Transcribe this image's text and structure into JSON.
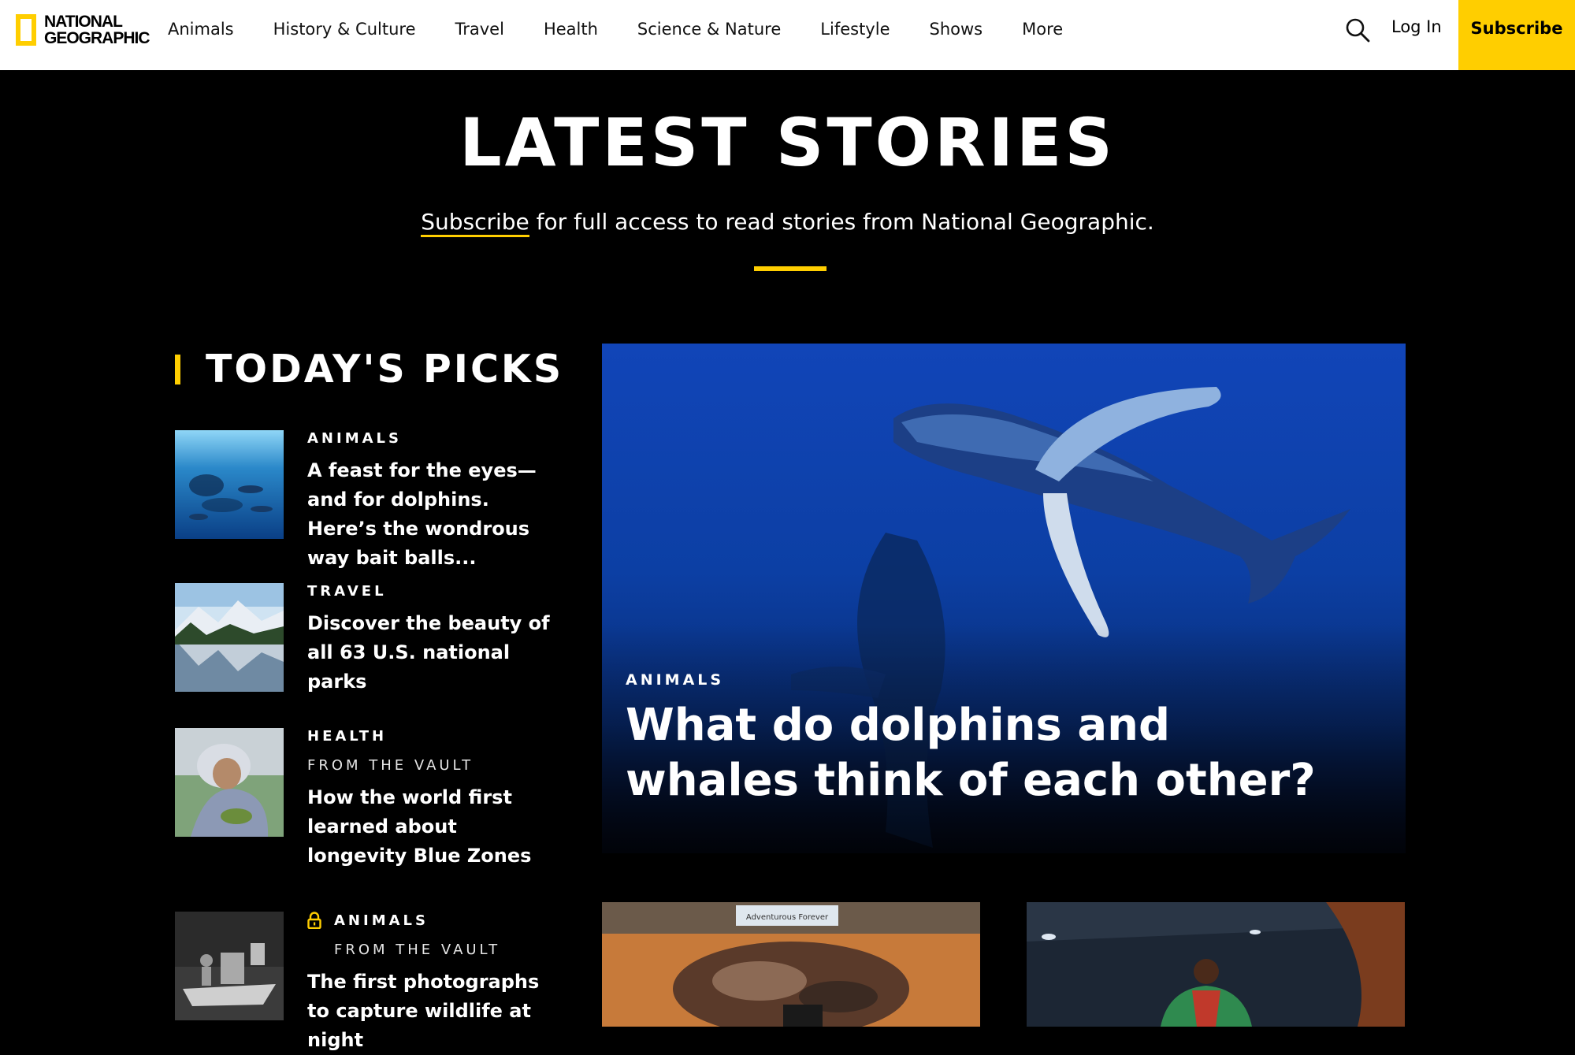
{
  "header": {
    "logo": {
      "line1": "NATIONAL",
      "line2": "GEOGRAPHIC"
    },
    "nav": [
      "Animals",
      "History & Culture",
      "Travel",
      "Health",
      "Science & Nature",
      "Lifestyle",
      "Shows",
      "More"
    ],
    "search_icon": "search-icon",
    "login_label": "Log In",
    "subscribe_label": "Subscribe"
  },
  "hero": {
    "title": "LATEST STORIES",
    "subscribe_link": "Subscribe",
    "subline_rest": " for full access to read stories from National Geographic."
  },
  "picks": {
    "title": "TODAY'S PICKS",
    "items": [
      {
        "category": "ANIMALS",
        "vault": "",
        "headline": "A feast for the eyes—and for dolphins. Here’s the wondrous way bait balls...",
        "locked": false
      },
      {
        "category": "TRAVEL",
        "vault": "",
        "headline": "Discover the beauty of all 63 U.S. national parks",
        "locked": false
      },
      {
        "category": "HEALTH",
        "vault": "FROM THE VAULT",
        "headline": "How the world first learned about longevity Blue Zones",
        "locked": false
      },
      {
        "category": "ANIMALS",
        "vault": "FROM THE VAULT",
        "headline": "The first photographs to capture wildlife at night",
        "locked": true,
        "lock_icon": "lock-icon"
      }
    ]
  },
  "feature": {
    "category": "ANIMALS",
    "headline": "What do dolphins and whales think of each other?"
  },
  "cards": [
    {
      "banner_text": "Adventurous Forever"
    },
    {
      "banner_text": ""
    }
  ],
  "colors": {
    "accent": "#FFCE00",
    "background": "#000000",
    "header_bg": "#FFFFFF"
  }
}
